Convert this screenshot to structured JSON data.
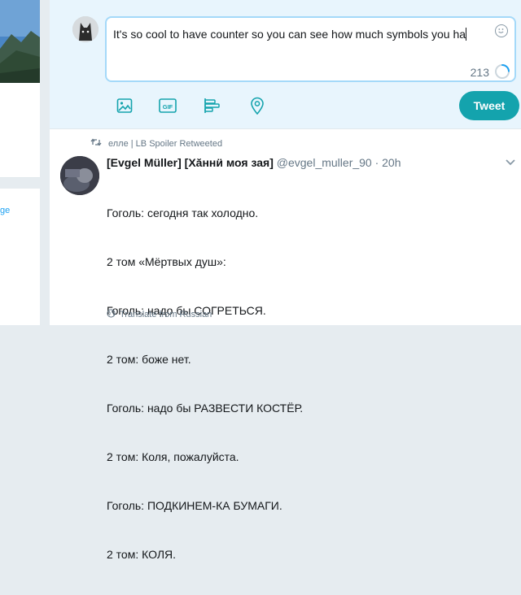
{
  "left_panel": {
    "link_text": "ge"
  },
  "composer": {
    "text": "It's so cool to have counter so you can see how much symbols you ha",
    "counter": "213",
    "progress_fraction": 0.24,
    "tweet_label": "Tweet",
    "tools": [
      "image-icon",
      "gif-icon",
      "poll-icon",
      "location-icon"
    ]
  },
  "tweet": {
    "retweet_line": "елле | LB Spoiler Retweeted",
    "author_name": "[Evgel Müller] [Хăннӥ моя зая]",
    "handle_time": "@evgel_muller_90 · 20h",
    "lines": [
      "Гоголь: сегодня так холодно.",
      "2 том «Мёртвых душ»:",
      "Гоголь: надо бы СОГРЕТЬСЯ.",
      "2 том: боже нет.",
      "Гоголь: надо бы РАЗВЕСТИ КОСТЁР.",
      "2 том: Коля, пожалуйста.",
      "Гоголь: ПОДКИНЕМ-КА БУМАГИ.",
      "2 том: КОЛЯ."
    ],
    "translate_text": "Translate from Russian"
  },
  "colors": {
    "accent": "#14a3ad",
    "composer_bg": "#e8f5fd",
    "muted_text": "#657786",
    "page_bg": "#e6ecf0"
  }
}
